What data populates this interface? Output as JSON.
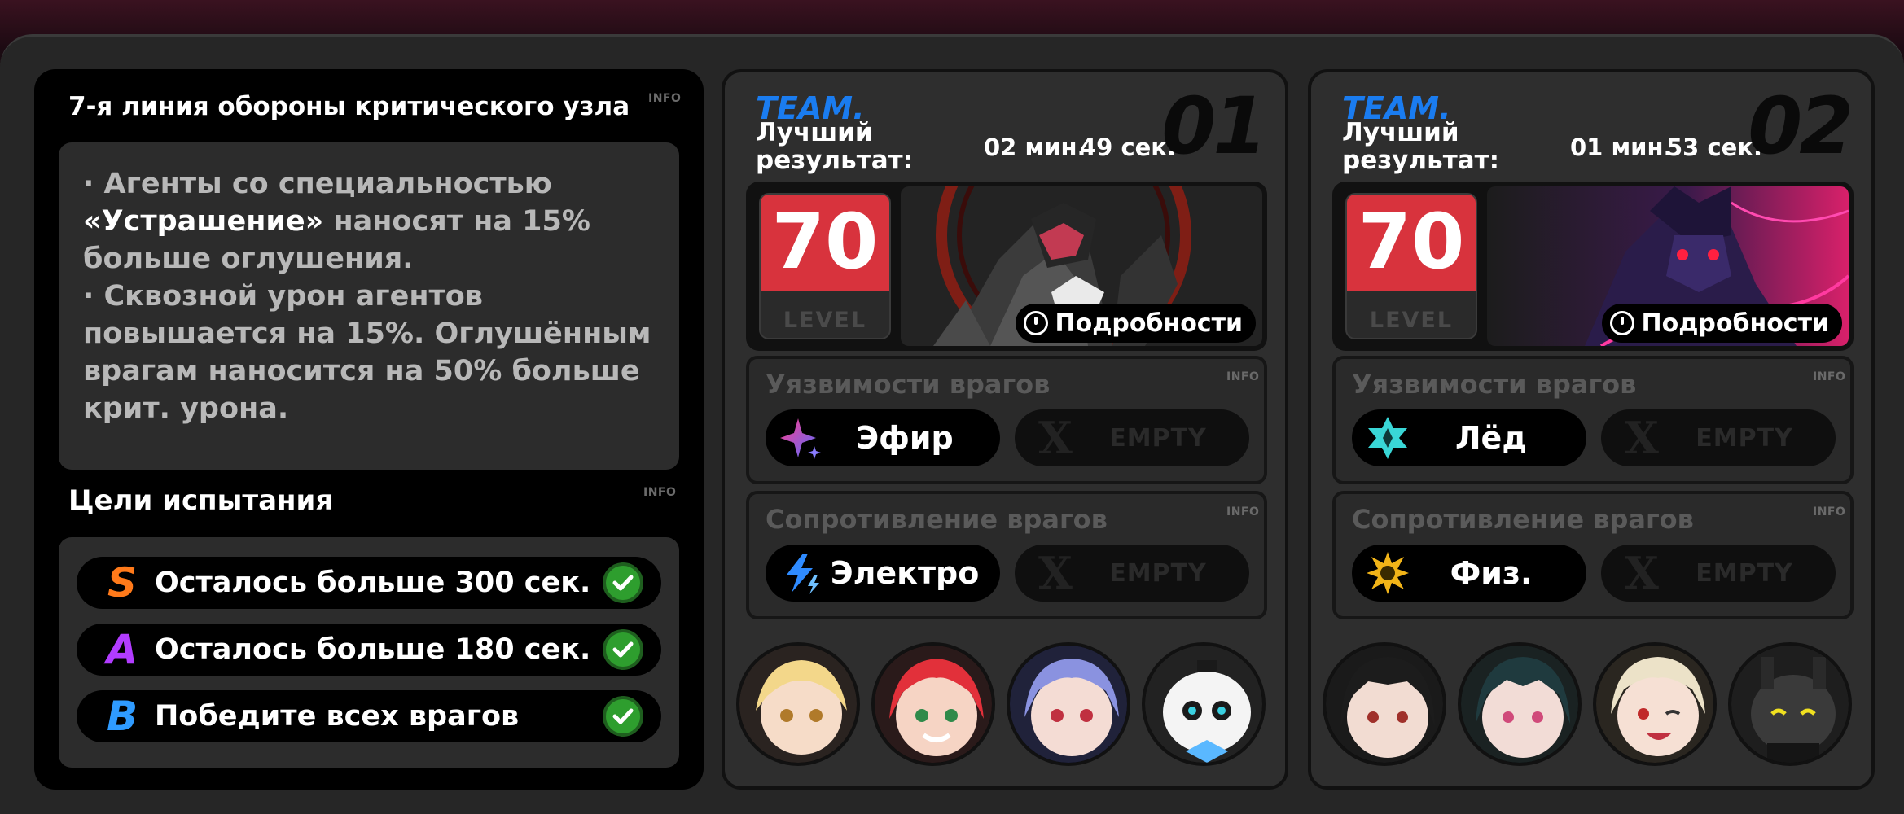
{
  "stage": {
    "title": "7-я линия обороны критического узла",
    "info": "INFO",
    "buff_parts": [
      "· Агенты со специальностью ",
      "«Устрашение»",
      " наносят на 15% больше оглушения.",
      "· Сквозной урон агентов повышается на 15%. Оглушённым врагам наносится на 50% больше крит. урона."
    ]
  },
  "goals": {
    "title": "Цели испытания",
    "info": "INFO",
    "items": [
      {
        "rank": "S",
        "text": "Осталось больше 300 сек.",
        "color": "#ff7a1a"
      },
      {
        "rank": "A",
        "text": "Осталось больше 180 сек.",
        "color": "#b23cff"
      },
      {
        "rank": "B",
        "text": "Победите всех врагов",
        "color": "#2f9bff"
      }
    ]
  },
  "teams": [
    {
      "team_label": "TEAM.",
      "best_label": "Лучший результат:",
      "minutes": "02 мин.",
      "seconds": "49 сек.",
      "number": "01",
      "level": "70",
      "level_word": "LEVEL",
      "details": "Подробности",
      "weakness_title": "Уязвимости врагов",
      "weakness": "Эфир",
      "resistance_title": "Сопротивление врагов",
      "resistance": "Электро",
      "empty": "EMPTY",
      "info": "INFO",
      "empty_x": "X"
    },
    {
      "team_label": "TEAM.",
      "best_label": "Лучший результат:",
      "minutes": "01 мин.",
      "seconds": "53 сек.",
      "number": "02",
      "level": "70",
      "level_word": "LEVEL",
      "details": "Подробности",
      "weakness_title": "Уязвимости врагов",
      "weakness": "Лёд",
      "resistance_title": "Сопротивление врагов",
      "resistance": "Физ.",
      "empty": "EMPTY",
      "info": "INFO",
      "empty_x": "X"
    }
  ],
  "colors": {
    "team_blue": "#1a7cf0",
    "level_red": "#d8333d",
    "check_green": "#2e9e2e"
  }
}
